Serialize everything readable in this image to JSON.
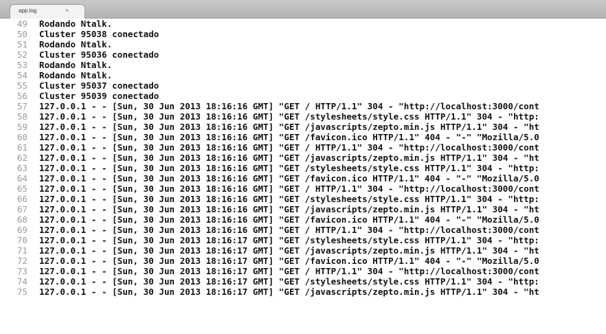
{
  "tab": {
    "title": "app.log",
    "close_glyph": "×"
  },
  "editor": {
    "lines": [
      {
        "n": "49",
        "text": "Rodando Ntalk."
      },
      {
        "n": "50",
        "text": "Cluster 95038 conectado"
      },
      {
        "n": "51",
        "text": "Rodando Ntalk."
      },
      {
        "n": "52",
        "text": "Cluster 95036 conectado"
      },
      {
        "n": "53",
        "text": "Rodando Ntalk."
      },
      {
        "n": "54",
        "text": "Rodando Ntalk."
      },
      {
        "n": "55",
        "text": "Cluster 95037 conectado"
      },
      {
        "n": "56",
        "text": "Cluster 95039 conectado"
      },
      {
        "n": "57",
        "text": "127.0.0.1 - - [Sun, 30 Jun 2013 18:16:16 GMT] \"GET / HTTP/1.1\" 304 - \"http://localhost:3000/cont"
      },
      {
        "n": "58",
        "text": "127.0.0.1 - - [Sun, 30 Jun 2013 18:16:16 GMT] \"GET /stylesheets/style.css HTTP/1.1\" 304 - \"http:"
      },
      {
        "n": "59",
        "text": "127.0.0.1 - - [Sun, 30 Jun 2013 18:16:16 GMT] \"GET /javascripts/zepto.min.js HTTP/1.1\" 304 - \"ht"
      },
      {
        "n": "60",
        "text": "127.0.0.1 - - [Sun, 30 Jun 2013 18:16:16 GMT] \"GET /favicon.ico HTTP/1.1\" 404 - \"-\" \"Mozilla/5.0"
      },
      {
        "n": "61",
        "text": "127.0.0.1 - - [Sun, 30 Jun 2013 18:16:16 GMT] \"GET / HTTP/1.1\" 304 - \"http://localhost:3000/cont"
      },
      {
        "n": "62",
        "text": "127.0.0.1 - - [Sun, 30 Jun 2013 18:16:16 GMT] \"GET /javascripts/zepto.min.js HTTP/1.1\" 304 - \"ht"
      },
      {
        "n": "63",
        "text": "127.0.0.1 - - [Sun, 30 Jun 2013 18:16:16 GMT] \"GET /stylesheets/style.css HTTP/1.1\" 304 - \"http:"
      },
      {
        "n": "64",
        "text": "127.0.0.1 - - [Sun, 30 Jun 2013 18:16:16 GMT] \"GET /favicon.ico HTTP/1.1\" 404 - \"-\" \"Mozilla/5.0"
      },
      {
        "n": "65",
        "text": "127.0.0.1 - - [Sun, 30 Jun 2013 18:16:16 GMT] \"GET / HTTP/1.1\" 304 - \"http://localhost:3000/cont"
      },
      {
        "n": "66",
        "text": "127.0.0.1 - - [Sun, 30 Jun 2013 18:16:16 GMT] \"GET /stylesheets/style.css HTTP/1.1\" 304 - \"http:"
      },
      {
        "n": "67",
        "text": "127.0.0.1 - - [Sun, 30 Jun 2013 18:16:16 GMT] \"GET /javascripts/zepto.min.js HTTP/1.1\" 304 - \"ht"
      },
      {
        "n": "68",
        "text": "127.0.0.1 - - [Sun, 30 Jun 2013 18:16:16 GMT] \"GET /favicon.ico HTTP/1.1\" 404 - \"-\" \"Mozilla/5.0"
      },
      {
        "n": "69",
        "text": "127.0.0.1 - - [Sun, 30 Jun 2013 18:16:16 GMT] \"GET / HTTP/1.1\" 304 - \"http://localhost:3000/cont"
      },
      {
        "n": "70",
        "text": "127.0.0.1 - - [Sun, 30 Jun 2013 18:16:17 GMT] \"GET /stylesheets/style.css HTTP/1.1\" 304 - \"http:"
      },
      {
        "n": "71",
        "text": "127.0.0.1 - - [Sun, 30 Jun 2013 18:16:17 GMT] \"GET /javascripts/zepto.min.js HTTP/1.1\" 304 - \"ht"
      },
      {
        "n": "72",
        "text": "127.0.0.1 - - [Sun, 30 Jun 2013 18:16:17 GMT] \"GET /favicon.ico HTTP/1.1\" 404 - \"-\" \"Mozilla/5.0"
      },
      {
        "n": "73",
        "text": "127.0.0.1 - - [Sun, 30 Jun 2013 18:16:17 GMT] \"GET / HTTP/1.1\" 304 - \"http://localhost:3000/cont"
      },
      {
        "n": "74",
        "text": "127.0.0.1 - - [Sun, 30 Jun 2013 18:16:17 GMT] \"GET /stylesheets/style.css HTTP/1.1\" 304 - \"http:"
      },
      {
        "n": "75",
        "text": "127.0.0.1 - - [Sun, 30 Jun 2013 18:16:17 GMT] \"GET /javascripts/zepto.min.js HTTP/1.1\" 304 - \"ht"
      }
    ]
  },
  "colors": {
    "tabbar_bg": "#bdbdbd",
    "tab_bg": "#f3f3f3",
    "line_number": "#9a9a9a",
    "text": "#111111",
    "editor_bg": "#ffffff"
  }
}
